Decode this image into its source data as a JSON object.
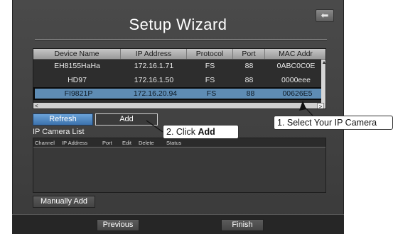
{
  "window": {
    "title": "Setup Wizard",
    "back_icon_glyph": "⬅"
  },
  "device_table": {
    "columns": [
      "Device Name",
      "IP Address",
      "Protocol",
      "Port",
      "MAC Addr"
    ],
    "rows": [
      {
        "name": "EH8155HaHa",
        "ip": "172.16.1.71",
        "protocol": "FS",
        "port": "88",
        "mac": "0ABC0C0E"
      },
      {
        "name": "HD97",
        "ip": "172.16.1.50",
        "protocol": "FS",
        "port": "88",
        "mac": "0000eee"
      },
      {
        "name": "FI9821P",
        "ip": "172.16.20.94",
        "protocol": "FS",
        "port": "88",
        "mac": "00626E5"
      }
    ],
    "selected_index": 2
  },
  "buttons": {
    "refresh": "Refresh",
    "add": "Add",
    "manual_add": "Manually Add",
    "previous": "Previous",
    "finish": "Finish"
  },
  "camera_list": {
    "label": "IP Camera List",
    "columns": [
      "Channel",
      "IP Address",
      "Port",
      "Edit",
      "Delete",
      "Status"
    ]
  },
  "callouts": {
    "step1": "1. Select Your IP Camera",
    "step2_prefix": "2. Click ",
    "step2_bold": "Add"
  },
  "colors": {
    "selected_row": "#5e8cb4",
    "refresh_button": "#4f88c4",
    "background": "#3f3f3f"
  }
}
